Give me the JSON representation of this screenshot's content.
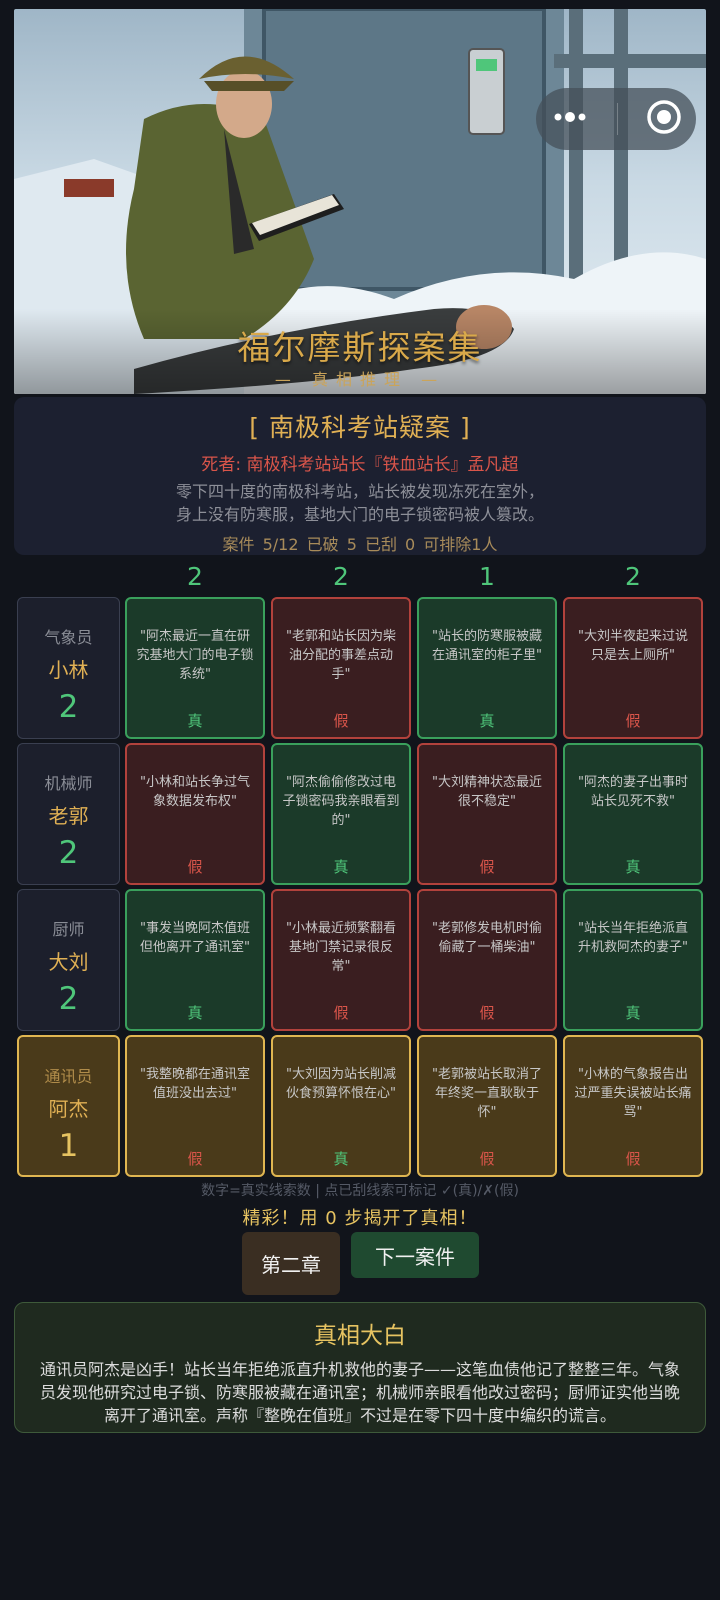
{
  "hero": {
    "title": "福尔摩斯探案集",
    "subtitle": "— 真相推理 —"
  },
  "capsule": {
    "menu_icon": "more-dots-icon",
    "close_icon": "target-icon"
  },
  "case": {
    "title": "[ 南极科考站疑案 ]",
    "victim": "死者: 南极科考站站长『铁血站长』孟凡超",
    "desc_line1": "零下四十度的南极科考站，站长被发现冻死在室外，",
    "desc_line2": "身上没有防寒服，基地大门的电子锁密码被人篡改。",
    "stats": "案件 5/12  已破 5  已刮 0  可排除1人"
  },
  "column_counts": [
    "2",
    "2",
    "1",
    "2"
  ],
  "suspects": [
    {
      "role": "气象员",
      "name": "小林",
      "count": "2",
      "clues": [
        {
          "text": "\"阿杰最近一直在研究基地大门的电子锁系统\"",
          "verdict": "真"
        },
        {
          "text": "\"老郭和站长因为柴油分配的事差点动手\"",
          "verdict": "假"
        },
        {
          "text": "\"站长的防寒服被藏在通讯室的柜子里\"",
          "verdict": "真"
        },
        {
          "text": "\"大刘半夜起来过说只是去上厕所\"",
          "verdict": "假"
        }
      ]
    },
    {
      "role": "机械师",
      "name": "老郭",
      "count": "2",
      "clues": [
        {
          "text": "\"小林和站长争过气象数据发布权\"",
          "verdict": "假"
        },
        {
          "text": "\"阿杰偷偷修改过电子锁密码我亲眼看到的\"",
          "verdict": "真"
        },
        {
          "text": "\"大刘精神状态最近很不稳定\"",
          "verdict": "假"
        },
        {
          "text": "\"阿杰的妻子出事时站长见死不救\"",
          "verdict": "真"
        }
      ]
    },
    {
      "role": "厨师",
      "name": "大刘",
      "count": "2",
      "clues": [
        {
          "text": "\"事发当晚阿杰值班但他离开了通讯室\"",
          "verdict": "真"
        },
        {
          "text": "\"小林最近频繁翻看基地门禁记录很反常\"",
          "verdict": "假"
        },
        {
          "text": "\"老郭修发电机时偷偷藏了一桶柴油\"",
          "verdict": "假"
        },
        {
          "text": "\"站长当年拒绝派直升机救阿杰的妻子\"",
          "verdict": "真"
        }
      ]
    },
    {
      "role": "通讯员",
      "name": "阿杰",
      "count": "1",
      "clues": [
        {
          "text": "\"我整晚都在通讯室值班没出去过\"",
          "verdict": "假"
        },
        {
          "text": "\"大刘因为站长削减伙食预算怀恨在心\"",
          "verdict": "真"
        },
        {
          "text": "\"老郭被站长取消了年终奖一直耿耿于怀\"",
          "verdict": "假"
        },
        {
          "text": "\"小林的气象报告出过严重失误被站长痛骂\"",
          "verdict": "假"
        }
      ]
    }
  ],
  "legend": "数字=真实线索数 | 点已刮线索可标记 ✓(真)/✗(假)",
  "praise": "精彩！用 0 步揭开了真相！",
  "buttons": {
    "chapter": "第二章",
    "next": "下一案件"
  },
  "truth": {
    "title": "真相大白",
    "body": "通讯员阿杰是凶手！站长当年拒绝派直升机救他的妻子——这笔血债他记了整整三年。气象员发现他研究过电子锁、防寒服被藏在通讯室；机械师亲眼看他改过密码；厨师证实他当晚离开了通讯室。声称『整晚在值班』不过是在零下四十度中编织的谎言。"
  },
  "colors": {
    "true": "#4fc67a",
    "false": "#d9554a",
    "accent": "#e0b054"
  }
}
